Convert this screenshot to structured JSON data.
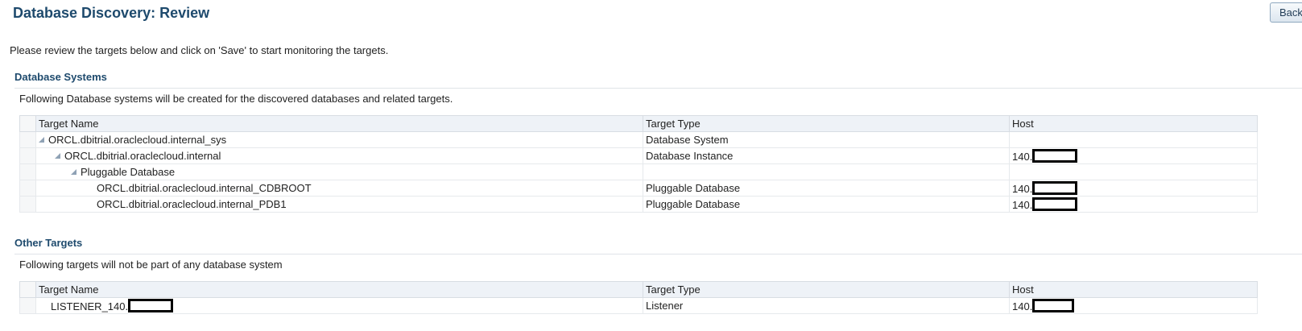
{
  "header": {
    "title": "Database Discovery: Review",
    "back_label": "Back"
  },
  "intro_text": "Please review the targets below and click on 'Save' to start monitoring the targets.",
  "database_systems": {
    "title": "Database Systems",
    "description": "Following Database systems will be created for the discovered databases and related targets.",
    "columns": [
      "Target Name",
      "Target Type",
      "Host"
    ],
    "rows": [
      {
        "name": "ORCL.dbitrial.oraclecloud.internal_sys",
        "type": "Database System",
        "host": ""
      },
      {
        "name": "ORCL.dbitrial.oraclecloud.internal",
        "type": "Database Instance",
        "host": "140."
      },
      {
        "name": "Pluggable Database",
        "type": "",
        "host": ""
      },
      {
        "name": "ORCL.dbitrial.oraclecloud.internal_CDBROOT",
        "type": "Pluggable Database",
        "host": "140."
      },
      {
        "name": "ORCL.dbitrial.oraclecloud.internal_PDB1",
        "type": "Pluggable Database",
        "host": "140."
      }
    ]
  },
  "other_targets": {
    "title": "Other Targets",
    "description": "Following targets will not be part of any database system",
    "columns": [
      "Target Name",
      "Target Type",
      "Host"
    ],
    "rows": [
      {
        "name": "LISTENER_140.",
        "type": "Listener",
        "host": "140."
      }
    ]
  },
  "icons": {
    "expanded": "expanded-disclosure-icon",
    "redacted": "redaction-box"
  },
  "colors": {
    "title": "#1e4a6d",
    "header_bg": "#eef2f7"
  }
}
